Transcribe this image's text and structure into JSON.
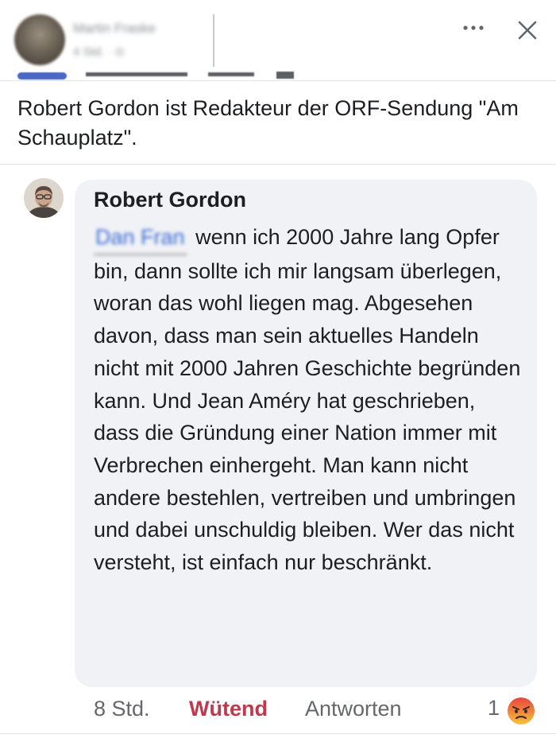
{
  "post_header": {
    "author_name": "Martin Fraske",
    "meta": "4 Std. · ⊙",
    "more_icon": "more-dots-icon",
    "close_icon": "close-icon"
  },
  "caption": {
    "text": "Robert Gordon ist Redakteur der ORF-Sendung \"Am Schauplatz\"."
  },
  "comment": {
    "author": "Robert Gordon",
    "mention": "Dan Fran",
    "text": "wenn ich 2000 Jahre lang Opfer bin, dann sollte ich mir langsam überlegen, woran das wohl liegen mag. Abgesehen davon, dass man sein aktuelles Handeln nicht mit 2000 Jahren Geschichte begründen kann. Und Jean Améry hat geschrieben, dass die Gründung einer Nation immer mit Verbrechen einhergeht. Man kann nicht andere bestehlen, vertreiben und umbringen und dabei unschuldig bleiben. Wer das nicht versteht, ist einfach nur beschränkt.",
    "time": "8 Std.",
    "reaction_label": "Wütend",
    "reply_label": "Antworten",
    "reaction_count": "1",
    "reaction_icon": "angry-face-icon"
  },
  "colors": {
    "reaction_red": "#c0384b",
    "bubble_bg": "#f0f2f5",
    "secondary_text": "#65676b"
  }
}
